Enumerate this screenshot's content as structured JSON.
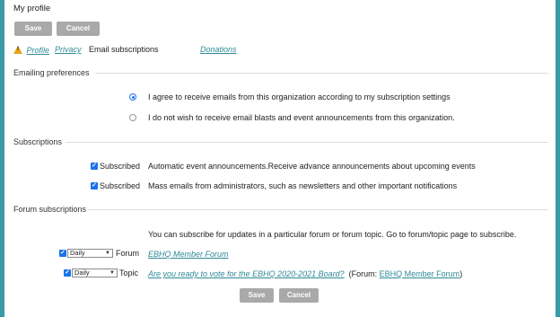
{
  "page_title": "My profile",
  "top_actions": {
    "save_label": "Save",
    "cancel_label": "Cancel"
  },
  "tabs": {
    "profile": "Profile",
    "privacy": "Privacy",
    "email_subscriptions": "Email subscriptions",
    "donations": "Donations"
  },
  "emailing_preferences": {
    "heading": "Emailing preferences",
    "options": [
      {
        "label": "I agree to receive emails from this organization according to my subscription settings",
        "selected": true
      },
      {
        "label": "I do not wish to receive email blasts and event announcements from this organization.",
        "selected": false
      }
    ]
  },
  "subscriptions": {
    "heading": "Subscriptions",
    "items": [
      {
        "status": "Subscribed",
        "checked": true,
        "description": "Automatic event announcements.Receive advance announcements about upcoming events"
      },
      {
        "status": "Subscribed",
        "checked": true,
        "description": "Mass emails from administrators, such as newsletters and other important notifications"
      }
    ]
  },
  "forum_subscriptions": {
    "heading": "Forum subscriptions",
    "intro": "You can subscribe for updates in a particular forum or forum topic. Go to forum/topic page to subscribe.",
    "items": [
      {
        "checked": true,
        "frequency": "Daily",
        "kind": "Forum",
        "title": "EBHQ Member Forum"
      },
      {
        "checked": true,
        "frequency": "Daily",
        "kind": "Topic",
        "title": "Are you ready to vote for the EBHQ 2020-2021 Board?",
        "forum_prefix": "(Forum: ",
        "forum_name": "EBHQ Member Forum",
        "forum_suffix": ")"
      }
    ]
  },
  "bottom_actions": {
    "save_label": "Save",
    "cancel_label": "Cancel"
  },
  "colors": {
    "background": "#3a9aa6",
    "link": "#2f8a97",
    "button": "#a9a9a9",
    "accent": "#1a73e8",
    "warning": "#e8a317"
  }
}
